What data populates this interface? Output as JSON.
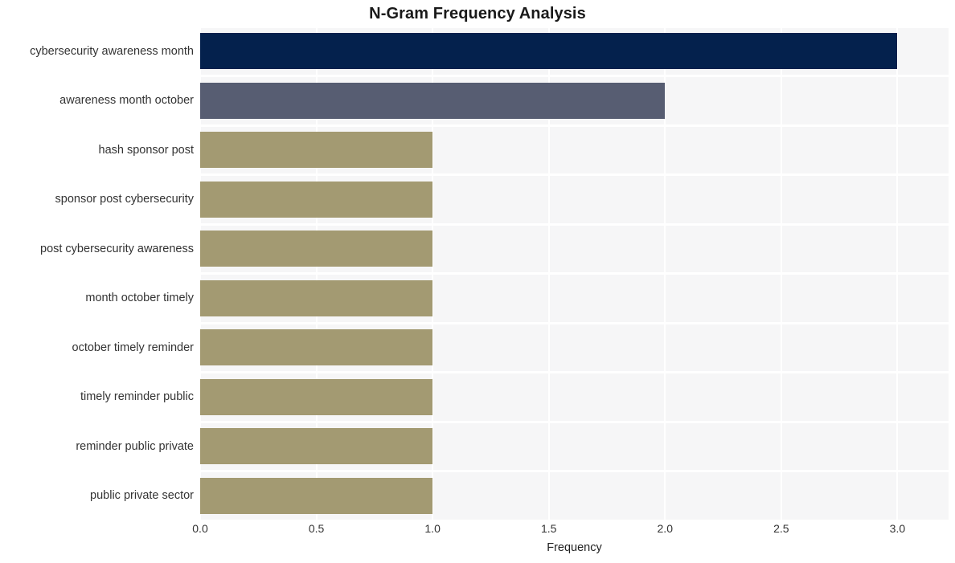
{
  "chart_data": {
    "type": "bar",
    "orientation": "horizontal",
    "title": "N-Gram Frequency Analysis",
    "xlabel": "Frequency",
    "ylabel": "",
    "categories": [
      "cybersecurity awareness month",
      "awareness month october",
      "hash sponsor post",
      "sponsor post cybersecurity",
      "post cybersecurity awareness",
      "month october timely",
      "october timely reminder",
      "timely reminder public",
      "reminder public private",
      "public private sector"
    ],
    "values": [
      3,
      2,
      1,
      1,
      1,
      1,
      1,
      1,
      1,
      1
    ],
    "bar_colors": [
      "#04214d",
      "#575d72",
      "#a39a72",
      "#a39a72",
      "#a39a72",
      "#a39a72",
      "#a39a72",
      "#a39a72",
      "#a39a72",
      "#a39a72"
    ],
    "xlim": [
      0,
      3.22
    ],
    "xticks": [
      0,
      0.5,
      1,
      1.5,
      2,
      2.5,
      3
    ],
    "xticklabels": [
      "0.0",
      "0.5",
      "1.0",
      "1.5",
      "2.0",
      "2.5",
      "3.0"
    ],
    "grid": true,
    "legend": null,
    "plot_background": "#f6f6f7",
    "gridline_color": "#ffffff",
    "figure_background": "#ffffff"
  }
}
